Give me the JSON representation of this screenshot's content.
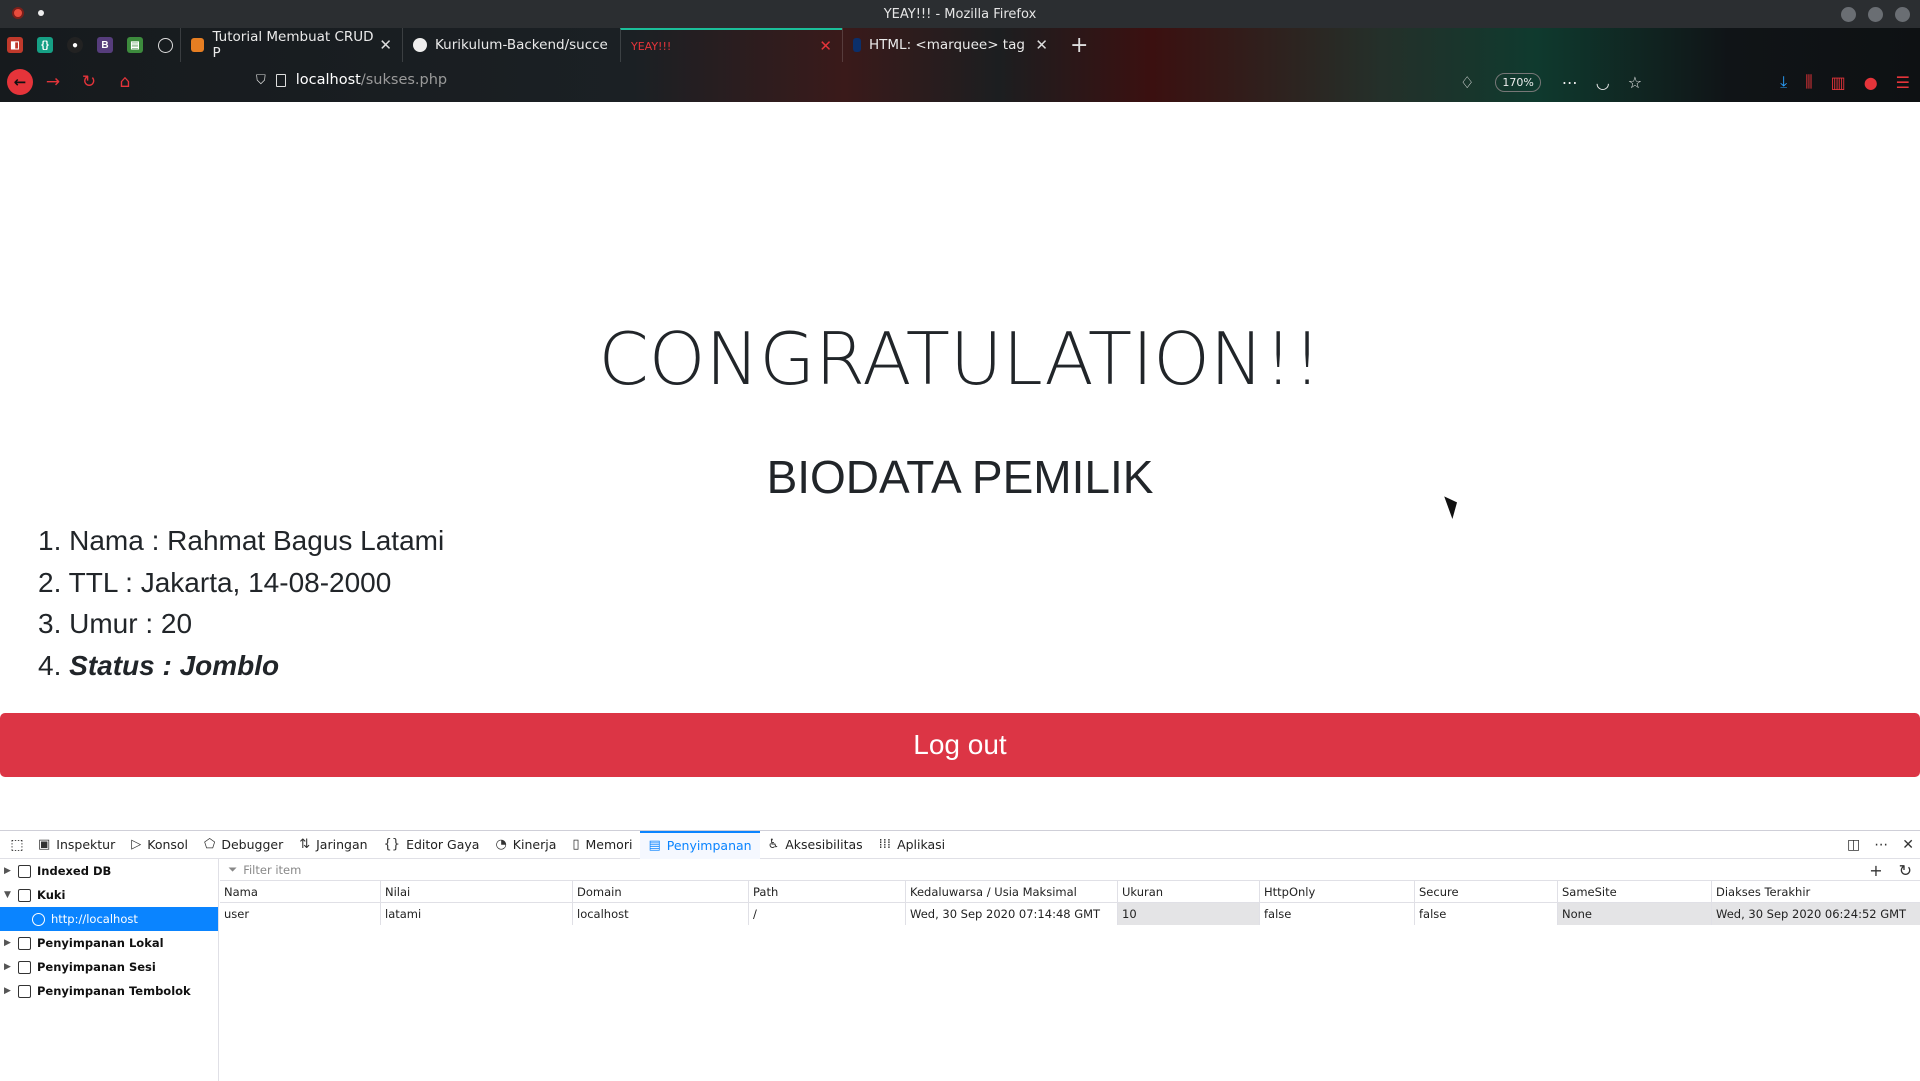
{
  "window": {
    "title": "YEAY!!! - Mozilla Firefox"
  },
  "tabs": [
    {
      "label": "Tutorial Membuat CRUD P",
      "active": false
    },
    {
      "label": "Kurikulum-Backend/succe",
      "active": false
    },
    {
      "label": "YEAY!!!",
      "active": true
    },
    {
      "label": "HTML: <marquee> tag",
      "active": false
    }
  ],
  "pinned_tabs": [
    "app-icon",
    "code-icon",
    "github-icon",
    "bootstrap-icon",
    "chart-icon",
    "globe-icon"
  ],
  "navbar": {
    "url_host": "localhost",
    "url_path": "/sukses.php",
    "zoom": "170%"
  },
  "page": {
    "heading": "CONGRATULATION!!",
    "subheading": "BIODATA PEMILIK",
    "bio": [
      {
        "num": "1.",
        "text": "Nama : Rahmat Bagus Latami"
      },
      {
        "num": "2.",
        "text": "TTL : Jakarta, 14-08-2000"
      },
      {
        "num": "3.",
        "text": "Umur : 20"
      },
      {
        "num": "4.",
        "text": "Status : Jomblo"
      }
    ],
    "logout_label": "Log out"
  },
  "devtools": {
    "tabs": [
      "Inspektur",
      "Konsol",
      "Debugger",
      "Jaringan",
      "Editor Gaya",
      "Kinerja",
      "Memori",
      "Penyimpanan",
      "Aksesibilitas",
      "Aplikasi"
    ],
    "active_tab": "Penyimpanan",
    "sidebar": {
      "indexed_db": "Indexed DB",
      "kuki": "Kuki",
      "kuki_host": "http://localhost",
      "lokal": "Penyimpanan Lokal",
      "sesi": "Penyimpanan Sesi",
      "tembolok": "Penyimpanan Tembolok"
    },
    "filter_placeholder": "Filter item",
    "columns": [
      "Nama",
      "Nilai",
      "Domain",
      "Path",
      "Kedaluwarsa / Usia Maksimal",
      "Ukuran",
      "HttpOnly",
      "Secure",
      "SameSite",
      "Diakses Terakhir"
    ],
    "rows": [
      [
        "user",
        "latami",
        "localhost",
        "/",
        "Wed, 30 Sep 2020 07:14:48 GMT",
        "10",
        "false",
        "false",
        "None",
        "Wed, 30 Sep 2020 06:24:52 GMT"
      ]
    ]
  },
  "colors": {
    "accent_red": "#dc3545",
    "devtools_blue": "#0a84ff",
    "active_tab_top": "#1bbf9a"
  }
}
